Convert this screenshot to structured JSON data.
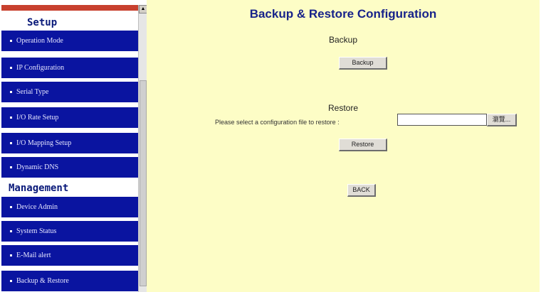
{
  "sidebar": {
    "scroll_up_glyph": "▲",
    "sections": [
      {
        "title": "Setup",
        "items": [
          {
            "label": "Operation Mode"
          },
          {
            "label": "IP Configuration"
          },
          {
            "label": "Serial Type"
          },
          {
            "label": "I/O Rate Setup"
          },
          {
            "label": "I/O Mapping Setup"
          },
          {
            "label": "Dynamic DNS"
          }
        ]
      },
      {
        "title": "Management",
        "items": [
          {
            "label": "Device Admin"
          },
          {
            "label": "System Status"
          },
          {
            "label": "E-Mail alert"
          },
          {
            "label": "Backup & Restore"
          }
        ]
      }
    ]
  },
  "main": {
    "title": "Backup & Restore Configuration",
    "backup": {
      "heading": "Backup",
      "button_label": "Backup"
    },
    "restore": {
      "heading": "Restore",
      "prompt": "Please select a configuration file to restore :",
      "file_value": "",
      "browse_label": "瀏覽...",
      "button_label": "Restore"
    },
    "back_label": "BACK"
  },
  "colors": {
    "nav_bg": "#0a14a0",
    "content_bg": "#fdfdc6",
    "title": "#17228a",
    "top_bar": "#c8402e"
  }
}
